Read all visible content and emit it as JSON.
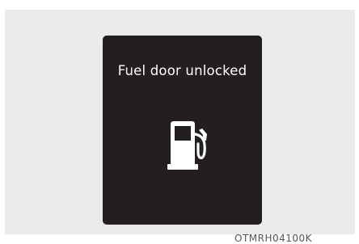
{
  "display": {
    "message": "Fuel door unlocked",
    "icon": "fuel-pump-icon",
    "background_color": "#231f20",
    "text_color": "#ffffff"
  },
  "panel": {
    "background_color": "#ebebeb"
  },
  "reference_code": "OTMRH04100K"
}
